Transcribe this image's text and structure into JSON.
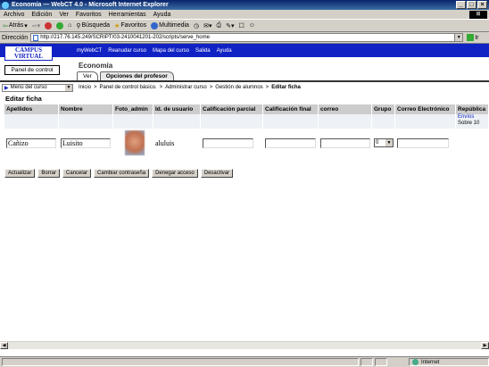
{
  "window": {
    "title": "Economía  —  WebCT 4.0 - Microsoft Internet Explorer"
  },
  "menubar": {
    "items": [
      "Archivo",
      "Edición",
      "Ver",
      "Favoritos",
      "Herramientas",
      "Ayuda"
    ]
  },
  "toolbar": {
    "back": "Atrás",
    "search": "Búsqueda",
    "favorites": "Favoritos",
    "multimedia": "Multimedia"
  },
  "address": {
    "label": "Dirección",
    "url": "http://217.76.145.249/SCRIPT/03-2410041201-202/scripts/serve_home",
    "go": "Ir"
  },
  "header": {
    "logo_line1": "CAMPUS",
    "logo_line2": "VIRTUAL",
    "nav": [
      "myWebCT",
      "Reanudar curso",
      "Mapa del curso",
      "Salida",
      "Ayuda"
    ]
  },
  "panel_button": "Panel de control",
  "course_title": "Economía",
  "tabs": [
    "Ver",
    "Opciones del profesor"
  ],
  "course_menu": "Menú del curso",
  "breadcrumb": [
    "Inicio",
    ">",
    "Panel de control básico.",
    ">",
    "Administrar curso",
    ">",
    "Gestión de alumnos",
    ">",
    "Editar ficha"
  ],
  "section_title": "Editar ficha",
  "table": {
    "columns": [
      "Apellidos",
      "Nombre",
      "Foto_admin",
      "Id. de usuario",
      "Calificación parcial",
      "Calificación final",
      "correo",
      "Grupo",
      "Correo Electrónico",
      "República"
    ],
    "envios_link": "Envíos",
    "envios_sub": "Sobre 10",
    "row": {
      "apellidos": "Cañizo",
      "nombre": "Luisito",
      "usuario": "aluluis",
      "grupo": "0"
    }
  },
  "actions": [
    "Actualizar",
    "Borrar",
    "Cancelar",
    "Cambiar contraseña",
    "Denegar acceso",
    "Desactivar"
  ],
  "status": {
    "zone": "Internet"
  }
}
